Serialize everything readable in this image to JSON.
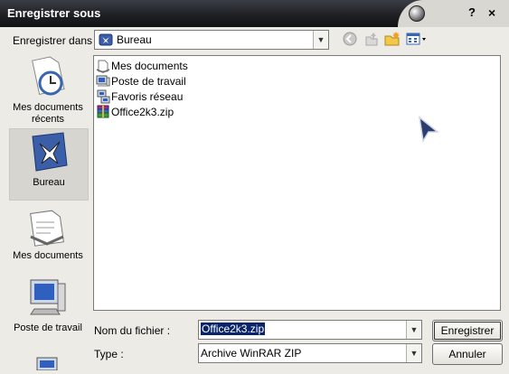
{
  "window": {
    "title": "Enregistrer sous",
    "help_glyph": "?",
    "close_glyph": "×"
  },
  "toolbar": {
    "save_in_label": "Enregistrer dans :",
    "save_in_value": "Bureau",
    "icons": [
      "back-icon",
      "up-folder-icon",
      "new-folder-icon",
      "views-menu-icon"
    ]
  },
  "places": [
    {
      "label": "Mes documents récents",
      "icon": "recent-documents-icon"
    },
    {
      "label": "Bureau",
      "icon": "desktop-icon",
      "selected": true
    },
    {
      "label": "Mes documents",
      "icon": "my-documents-icon"
    },
    {
      "label": "Poste de travail",
      "icon": "my-computer-icon"
    }
  ],
  "files": [
    {
      "name": "Mes documents",
      "icon": "my-documents-icon"
    },
    {
      "name": "Poste de travail",
      "icon": "my-computer-icon"
    },
    {
      "name": "Favoris réseau",
      "icon": "network-places-icon"
    },
    {
      "name": "Office2k3.zip",
      "icon": "winrar-archive-icon"
    }
  ],
  "form": {
    "filename_label": "Nom du fichier :",
    "filename_value": "Office2k3.zip",
    "type_label": "Type :",
    "type_value": "Archive WinRAR ZIP"
  },
  "buttons": {
    "save": "Enregistrer",
    "cancel": "Annuler"
  },
  "colors": {
    "titlebar": "#1c1e22",
    "selection": "#0a246a",
    "dialog_bg": "#ecebe6"
  }
}
